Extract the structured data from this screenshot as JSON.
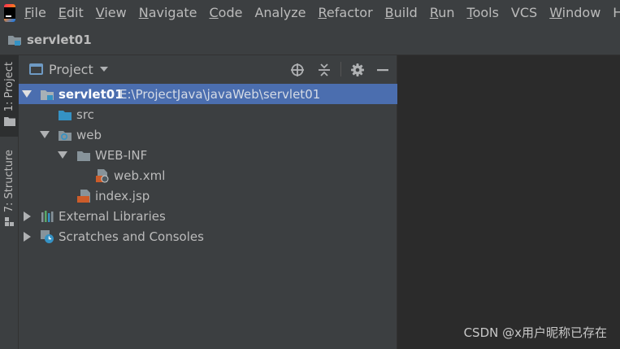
{
  "menubar": {
    "items": [
      {
        "mnemonic": "F",
        "rest": "ile"
      },
      {
        "mnemonic": "E",
        "rest": "dit"
      },
      {
        "mnemonic": "V",
        "rest": "iew"
      },
      {
        "mnemonic": "N",
        "rest": "avigate"
      },
      {
        "mnemonic": "C",
        "rest": "ode"
      },
      {
        "mnemonic": "",
        "rest": "Analyze"
      },
      {
        "mnemonic": "R",
        "rest": "efactor"
      },
      {
        "mnemonic": "B",
        "rest": "uild"
      },
      {
        "mnemonic": "R",
        "rest": "un"
      },
      {
        "mnemonic": "T",
        "rest": "ools"
      },
      {
        "mnemonic": "",
        "rest": "VCS"
      },
      {
        "mnemonic": "W",
        "rest": "indow"
      },
      {
        "mnemonic": "",
        "rest": "Help"
      }
    ]
  },
  "navbar": {
    "project_name": "servlet01"
  },
  "stripe": {
    "tab_project": "1: Project",
    "tab_structure": "7: Structure"
  },
  "panel": {
    "title": "Project"
  },
  "tree": {
    "root": {
      "name": "servlet01",
      "path": "E:\\ProjectJava\\javaWeb\\servlet01"
    },
    "src": "src",
    "web": "web",
    "web_inf": "WEB-INF",
    "web_xml": "web.xml",
    "index_jsp": "index.jsp",
    "external_libraries": "External Libraries",
    "scratches": "Scratches and Consoles"
  },
  "watermark": "CSDN @x用户昵称已存在",
  "colors": {
    "selection": "#4b6eaf",
    "panel_bg": "#3c3f41",
    "editor_bg": "#2b2b2b",
    "folder": "#87939a",
    "source_folder": "#3592c4"
  }
}
